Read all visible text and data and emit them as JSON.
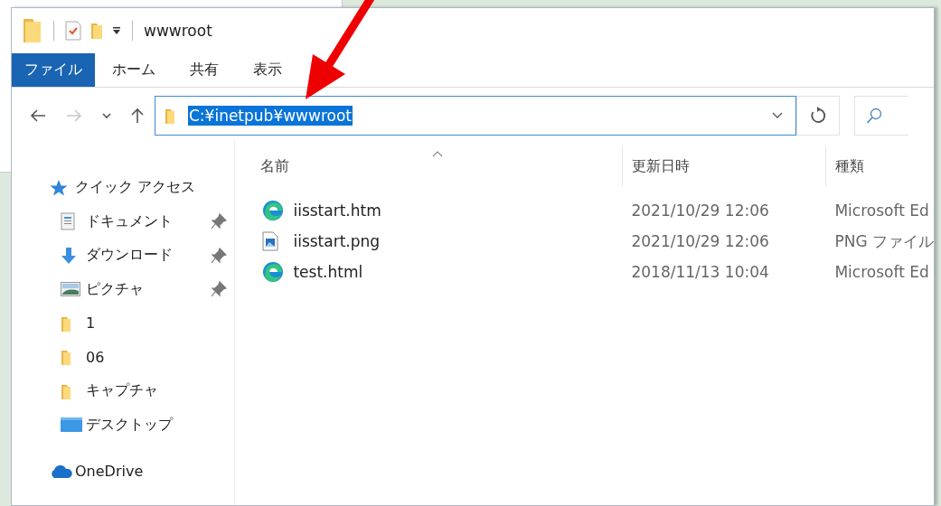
{
  "title_bar": {
    "quick_access": [
      {
        "kind": "folder"
      },
      {
        "kind": "separator"
      },
      {
        "kind": "properties"
      },
      {
        "kind": "new-folder"
      },
      {
        "kind": "dropdown"
      },
      {
        "kind": "separator"
      }
    ],
    "title": "wwwroot"
  },
  "ribbon_tabs": [
    {
      "label": "ファイル",
      "selected": true
    },
    {
      "label": "ホーム",
      "selected": false
    },
    {
      "label": "共有",
      "selected": false
    },
    {
      "label": "表示",
      "selected": false
    }
  ],
  "nav_buttons": [
    {
      "kind": "back",
      "disabled": false
    },
    {
      "kind": "forward",
      "disabled": true
    },
    {
      "kind": "recent",
      "disabled": false
    },
    {
      "kind": "up",
      "disabled": false
    }
  ],
  "address_bar": {
    "value": "C:¥inetpub¥wwwroot",
    "text_selected": true
  },
  "sidebar": {
    "items": [
      {
        "label": "クイック アクセス",
        "kind": "star",
        "pinned": false,
        "children": [
          {
            "label": "ドキュメント",
            "kind": "document",
            "pinned": true
          },
          {
            "label": "ダウンロード",
            "kind": "download",
            "pinned": true
          },
          {
            "label": "ピクチャ",
            "kind": "pictures",
            "pinned": true
          },
          {
            "label": "1",
            "kind": "folder",
            "pinned": false
          },
          {
            "label": "06",
            "kind": "folder",
            "pinned": false
          },
          {
            "label": "キャプチャ",
            "kind": "folder",
            "pinned": false
          },
          {
            "label": "デスクトップ",
            "kind": "desktop",
            "pinned": false
          }
        ]
      },
      {
        "label": "OneDrive",
        "kind": "cloud",
        "pinned": false
      }
    ]
  },
  "table": {
    "columns": [
      {
        "label": "名前",
        "sorted": true
      },
      {
        "label": "更新日時",
        "sorted": false
      },
      {
        "label": "種類",
        "sorted": false
      }
    ],
    "rows": [
      {
        "kind": "edge",
        "name": "iisstart.htm",
        "modified": "2021/10/29 12:06",
        "type": "Microsoft Ed"
      },
      {
        "kind": "image",
        "name": "iisstart.png",
        "modified": "2021/10/29 12:06",
        "type": "PNG ファイル"
      },
      {
        "kind": "edge",
        "name": "test.html",
        "modified": "2018/11/13 10:04",
        "type": "Microsoft Ed"
      }
    ]
  }
}
